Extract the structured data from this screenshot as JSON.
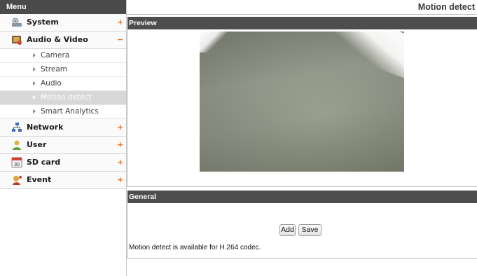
{
  "menu": {
    "title": "Menu",
    "categories": [
      {
        "label": "System",
        "sign": "+",
        "icon": "system-icon"
      },
      {
        "label": "Audio & Video",
        "sign": "−",
        "icon": "audio-video-icon"
      },
      {
        "label": "Network",
        "sign": "+",
        "icon": "network-icon"
      },
      {
        "label": "User",
        "sign": "+",
        "icon": "user-icon"
      },
      {
        "label": "SD card",
        "sign": "+",
        "icon": "sd-card-icon"
      },
      {
        "label": "Event",
        "sign": "+",
        "icon": "event-icon"
      }
    ],
    "audio_video_items": [
      "Camera",
      "Stream",
      "Audio",
      "Motion detect",
      "Smart Analytics"
    ],
    "active_item": "Motion detect"
  },
  "page": {
    "title": "Motion detect",
    "preview_heading": "Preview",
    "general_heading": "General",
    "add_label": "Add",
    "save_label": "Save",
    "note": "Motion detect is available for H.264 codec."
  },
  "colors": {
    "header_bar": "#4d4d4d",
    "accent_sign": "#e06a1c",
    "active_item_bg": "#d8d8d8"
  }
}
